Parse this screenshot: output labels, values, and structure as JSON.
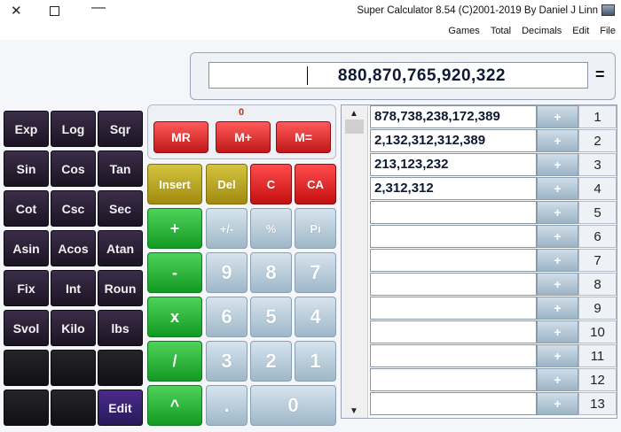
{
  "window": {
    "title": "Super Calculator 8.54 (C)2001-2019 By Daniel J Linn",
    "close_glyph": "✕",
    "minimize_glyph": "—"
  },
  "menu": [
    "File",
    "Edit",
    "Decimals",
    "Total",
    "Games"
  ],
  "display": {
    "equals": "=",
    "value": "880,870,765,920,322"
  },
  "memory": {
    "count": "0",
    "buttons": [
      "M=",
      "M+",
      "MR"
    ]
  },
  "sci_buttons": [
    [
      "Exp",
      "Log",
      "Sqr"
    ],
    [
      "Sin",
      "Cos",
      "Tan"
    ],
    [
      "Cot",
      "Csc",
      "Sec"
    ],
    [
      "Asin",
      "Acos",
      "Atan"
    ],
    [
      "Fix",
      "Int",
      "Roun"
    ],
    [
      "Svol",
      "Kilo",
      "lbs"
    ],
    [
      "",
      "",
      ""
    ],
    [
      "",
      "",
      "Edit"
    ]
  ],
  "keypad": {
    "row1": [
      "CA",
      "C",
      "Del",
      "Insert"
    ],
    "row2": [
      "Pi",
      "%",
      "+/-",
      "+"
    ],
    "row3": [
      "7",
      "8",
      "9",
      "-"
    ],
    "row4": [
      "4",
      "5",
      "6",
      "x"
    ],
    "row5": [
      "1",
      "2",
      "3",
      "/"
    ],
    "row6": [
      "0",
      ".",
      "^"
    ]
  },
  "list": {
    "plus_label": "+",
    "rows": [
      {
        "num": "1",
        "value": "878,738,238,172,389"
      },
      {
        "num": "2",
        "value": "2,132,312,312,389"
      },
      {
        "num": "3",
        "value": "213,123,232"
      },
      {
        "num": "4",
        "value": "2,312,312"
      },
      {
        "num": "5",
        "value": ""
      },
      {
        "num": "6",
        "value": ""
      },
      {
        "num": "7",
        "value": ""
      },
      {
        "num": "8",
        "value": ""
      },
      {
        "num": "9",
        "value": ""
      },
      {
        "num": "10",
        "value": ""
      },
      {
        "num": "11",
        "value": ""
      },
      {
        "num": "12",
        "value": ""
      },
      {
        "num": "13",
        "value": ""
      }
    ]
  },
  "colors": {
    "memory_red": "#e02424",
    "keypad_green": "#1fae2f",
    "display_text": "#0c1a33"
  }
}
